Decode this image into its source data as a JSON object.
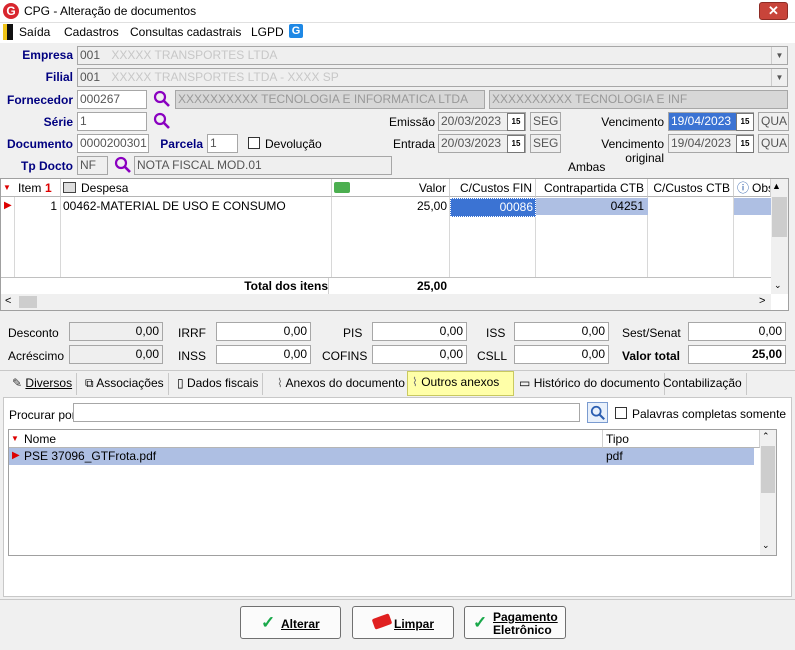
{
  "window": {
    "title": "CPG - Alteração de documentos",
    "close": "✕",
    "app_letter": "G"
  },
  "menu": {
    "items": [
      "Saída",
      "Cadastros",
      "Consultas cadastrais",
      "LGPD"
    ]
  },
  "form": {
    "empresa_label": "Empresa",
    "empresa_value": "001",
    "empresa_blur": "XXXXX TRANSPORTES LTDA",
    "filial_label": "Filial",
    "filial_value": "001",
    "filial_blur": "XXXXX TRANSPORTES LTDA - XXXX SP",
    "fornecedor_label": "Fornecedor",
    "fornecedor_value": "000267",
    "fornecedor_blur1": "XXXXXXXXXX TECNOLOGIA E INFORMATICA LTDA",
    "fornecedor_blur2": "XXXXXXXXXX TECNOLOGIA E INF",
    "serie_label": "Série",
    "serie_value": "1",
    "emissao_label": "Emissão",
    "emissao_value": "20/03/2023",
    "emissao_day": "SEG",
    "vencimento_label": "Vencimento",
    "vencimento_value": "19/04/2023",
    "vencimento_day": "QUA",
    "documento_label": "Documento",
    "documento_value": "0000200301",
    "parcela_label": "Parcela",
    "parcela_value": "1",
    "devolucao_label": "Devolução",
    "entrada_label": "Entrada",
    "entrada_value": "20/03/2023",
    "entrada_day": "SEG",
    "venc_original_label": "Vencimento original",
    "venc_original_value": "19/04/2023",
    "venc_original_day": "QUA",
    "tpdocto_label": "Tp Docto",
    "tpdocto_value": "NF",
    "tpdocto_desc": "NOTA FISCAL MOD.01",
    "ambas": "Ambas",
    "cal_glyph": "15"
  },
  "items_grid": {
    "columns": [
      "Item",
      "Despesa",
      "Valor",
      "C/Custos FIN",
      "Contrapartida CTB",
      "C/Custos CTB",
      "Obs"
    ],
    "sort_marker": "1",
    "rows": [
      {
        "item": "1",
        "despesa": "00462-MATERIAL DE USO E CONSUMO",
        "valor": "25,00",
        "ccustos_fin": "00086",
        "contrapartida": "04251",
        "ccustos_ctb": ""
      }
    ],
    "total_label": "Total dos itens",
    "total_value": "25,00"
  },
  "totals": {
    "desconto_label": "Desconto",
    "desconto": "0,00",
    "acrescimo_label": "Acréscimo",
    "acrescimo": "0,00",
    "irrf_label": "IRRF",
    "irrf": "0,00",
    "inss_label": "INSS",
    "inss": "0,00",
    "pis_label": "PIS",
    "pis": "0,00",
    "cofins_label": "COFINS",
    "cofins": "0,00",
    "iss_label": "ISS",
    "iss": "0,00",
    "csll_label": "CSLL",
    "csll": "0,00",
    "sest_label": "Sest/Senat",
    "sest": "0,00",
    "valor_total_label": "Valor total",
    "valor_total": "25,00"
  },
  "tabs": [
    "Diversos",
    "Associações",
    "Dados fiscais",
    "Anexos do documento",
    "Outros anexos",
    "Histórico do documento",
    "Contabilização"
  ],
  "attachments": {
    "search_label": "Procurar por:",
    "search_value": "",
    "palavras_label": "Palavras completas somente",
    "columns": [
      "Nome",
      "Tipo"
    ],
    "rows": [
      {
        "nome": "PSE 37096_GTFrota.pdf",
        "tipo": "pdf"
      }
    ]
  },
  "buttons": {
    "alterar": "Alterar",
    "limpar": "Limpar",
    "pagamento_line1": "Pagamento",
    "pagamento_line2": "Eletrônico"
  },
  "colors": {
    "accent_red": "#d8262e",
    "selection_blue": "#3b73d3",
    "row_highlight": "#aebfe3",
    "active_tab": "#ffffa8",
    "label_blue": "#000080",
    "magnifier": "#8a00c0"
  }
}
